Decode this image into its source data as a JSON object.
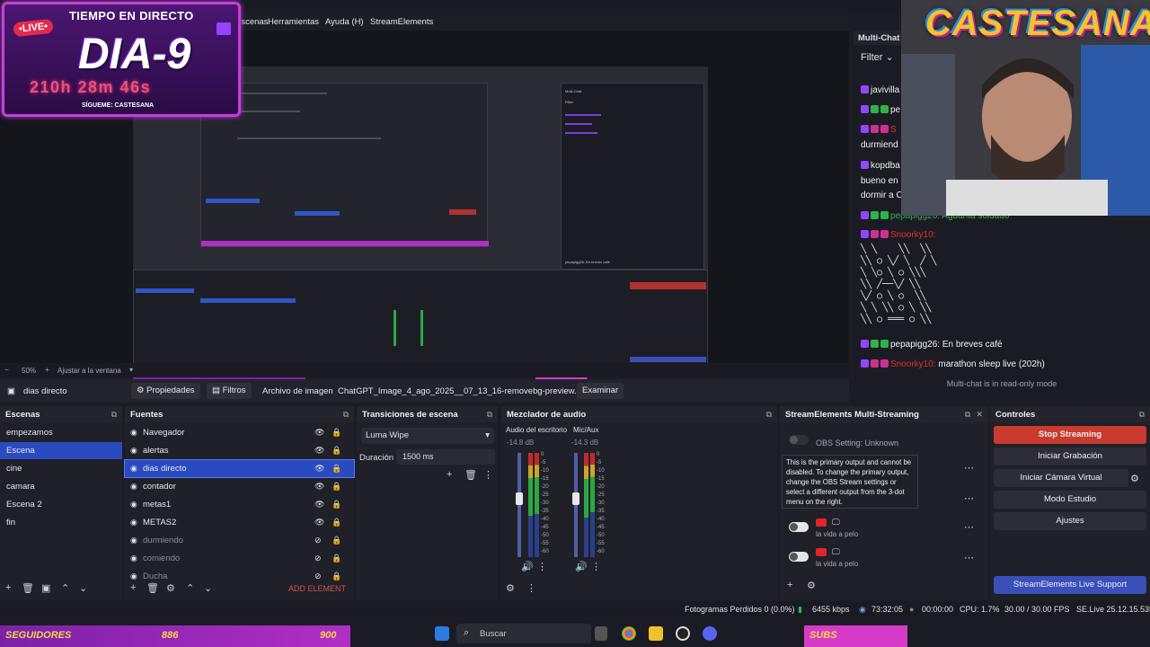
{
  "menubar": {
    "items": [
      "Escenas",
      "Herramientas",
      "Ayuda (H)",
      "StreamElements"
    ]
  },
  "overlay": {
    "title": "TIEMPO EN DIRECTO",
    "live": "•LIVE•",
    "day": "DIA-9",
    "time": "210h 28m 46s",
    "follow": "SÍGUEME: CASTESANA"
  },
  "brand": "CASTESANA",
  "zoom": {
    "level": "50%",
    "fit": "Ajustar a la ventana"
  },
  "propbar": {
    "source": "dias directo",
    "properties": "Propiedades",
    "filters": "Filtros",
    "image_file_label": "Archivo de imagen",
    "image_file": "ChatGPT_Image_4_ago_2025__07_13_16-removebg-preview.png",
    "browse": "Examinar"
  },
  "multichat": {
    "title": "Multi-Chat",
    "filter": "Filter",
    "lines": [
      {
        "user": "javivilla",
        "msg": ""
      },
      {
        "user": "pe",
        "msg": ""
      },
      {
        "user": "S",
        "msg": ""
      },
      {
        "user": "durmiend",
        "msg": ""
      },
      {
        "user": "kopdba",
        "msg": ""
      },
      {
        "user": "bueno en",
        "msg": ""
      },
      {
        "user": "dormir a C",
        "msg": ""
      }
    ],
    "partial": "pepapigg26: Aguanta soldado",
    "snoorky1": "Snoorky10:",
    "ascii": "╲ ╲    ╲╲  ╲╲\n╲╲ ○ ╲╱ ╲  ╱ ╲\n╲ ╲○ ╲ ○ ╲╲╲\n╲╲ ╱──╲╱ ╲╲\n╲╱ ○ ╲ ○  ╲╲\n╲ ╲ ╲╲ ○ ╲ ╲╲\n╲╲ ○ ═══ ○ ╲╲",
    "line_pepa": "pepapigg26: En breves café",
    "line_snoorky_user": "Snoorky10:",
    "line_snoorky_msg": " marathon sleep live (202h)",
    "readonly": "Multi-chat is in read-only mode"
  },
  "scenes": {
    "title": "Escenas",
    "items": [
      "empezamos",
      "Escena",
      "cine",
      "camara",
      "Escena 2",
      "fin"
    ],
    "selected": 1
  },
  "sources": {
    "title": "Fuentes",
    "items": [
      {
        "name": "Navegador",
        "visible": true
      },
      {
        "name": "alertas",
        "visible": true
      },
      {
        "name": "dias directo",
        "visible": true
      },
      {
        "name": "contador",
        "visible": true
      },
      {
        "name": "metas1",
        "visible": true
      },
      {
        "name": "METAS2",
        "visible": true
      },
      {
        "name": "durmiendo",
        "visible": false
      },
      {
        "name": "comiendo",
        "visible": false
      },
      {
        "name": "Ducha",
        "visible": false
      }
    ],
    "selected": 2,
    "add_element": "ADD ELEMENT"
  },
  "transitions": {
    "title": "Transiciones de escena",
    "selected": "Luma Wipe",
    "duration_label": "Duración",
    "duration": "1500 ms"
  },
  "mixer": {
    "title": "Mezclador de audio",
    "channels": [
      {
        "name": "Audio del escritorio",
        "db": "-14.8 dB"
      },
      {
        "name": "Mic/Aux",
        "db": "-14.3 dB"
      }
    ],
    "scale": [
      "0",
      "-5",
      "-10",
      "-15",
      "-20",
      "-25",
      "-30",
      "-35",
      "-40",
      "-45",
      "-50",
      "-55",
      "-60"
    ]
  },
  "streamelements": {
    "title": "StreamElements Multi-Streaming",
    "obs_setting": "OBS Setting: Unknown",
    "tooltip": "This is the primary output and cannot be disabled. To change the primary output, change the OBS Stream settings or select a different output from the 3-dot menu on the right.",
    "outputs": [
      {
        "label": "la vida a pelo"
      },
      {
        "label": "la vida a pelo"
      }
    ]
  },
  "controls": {
    "title": "Controles",
    "stop_streaming": "Stop Streaming",
    "start_recording": "Iniciar Grabación",
    "start_virtualcam": "Iniciar Cámara Virtual",
    "studio_mode": "Modo Estudio",
    "settings": "Ajustes",
    "support": "StreamElements Live Support"
  },
  "status": {
    "dropped": "Fotogramas Perdidos 0 (0.0%)",
    "kbps": "6455 kbps",
    "stream_time": "73:32:05",
    "rec_time": "00:00:00",
    "cpu": "CPU: 1.7%",
    "fps": "30.00 / 30.00 FPS",
    "version": "SE.Live 25.12.15.535"
  },
  "taskbar": {
    "banner_left": "SEGUIDORES",
    "banner_num1": "886",
    "banner_num2": "900",
    "banner_right": "SUBS",
    "search": "Buscar"
  },
  "colors": {
    "accent": "#2a4bbf",
    "stop": "#c83b2e",
    "support": "#3a4fb8",
    "overlay": "#c93dd8"
  }
}
